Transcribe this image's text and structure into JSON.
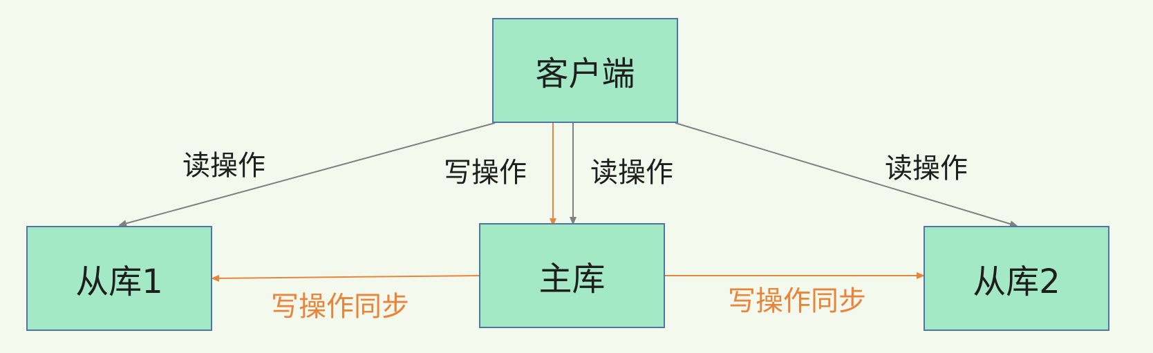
{
  "nodes": {
    "client": "客户端",
    "master": "主库",
    "replica1": "从库1",
    "replica2": "从库2"
  },
  "edges": {
    "read_left": "读操作",
    "write_center": "写操作",
    "read_center": "读操作",
    "read_right": "读操作",
    "sync_left": "写操作同步",
    "sync_right": "写操作同步"
  },
  "colors": {
    "background": "#f3f9ec",
    "box_fill": "#a4e9c6",
    "box_border": "#4f74a8",
    "read_arrow": "#808080",
    "write_arrow": "#e9843b"
  }
}
